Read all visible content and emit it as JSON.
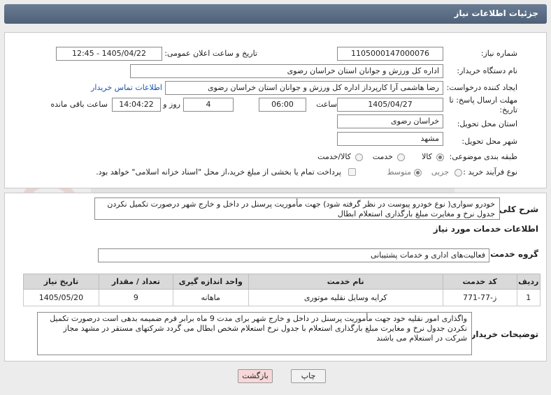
{
  "header": {
    "title": "جزئیات اطلاعات نیاز"
  },
  "fields": {
    "need_number_label": "شماره نیاز:",
    "need_number": "1105000147000076",
    "announce_label": "تاریخ و ساعت اعلان عمومی:",
    "announce_value": "1405/04/22 - 12:45",
    "buyer_org_label": "نام دستگاه خریدار:",
    "buyer_org": "اداره کل ورزش و جوانان استان خراسان رضوی",
    "requester_label": "ایجاد کننده درخواست:",
    "requester": "رضا هاشمی آرا کارپرداز اداره کل ورزش و جوانان استان خراسان رضوی",
    "contact_link": "اطلاعات تماس خریدار",
    "deadline_label_1": "مهلت ارسال پاسخ: تا",
    "deadline_label_2": "تاریخ:",
    "deadline_date": "1405/04/27",
    "time_label": "ساعت",
    "deadline_time": "06:00",
    "days_count": "4",
    "days_label": "روز و",
    "remaining_time": "14:04:22",
    "remaining_label": "ساعت باقی مانده",
    "province_label": "استان محل تحویل:",
    "province": "خراسان رضوی",
    "city_label": "شهر محل تحویل:",
    "city": "مشهد",
    "category_label": "طبقه بندی موضوعی:",
    "category_options": [
      "کالا",
      "خدمت",
      "کالا/خدمت"
    ],
    "purchase_type_label": "نوع فرآیند خرید :",
    "purchase_options": [
      "جزیی",
      "متوسط"
    ],
    "treasury_note": "پرداخت تمام یا بخشی از مبلغ خرید،از محل \"اسناد خزانه اسلامی\" خواهد بود."
  },
  "summary": {
    "label": "شرح کلی نیاز:",
    "text": "خودرو سواری( نوع خودرو پیوست در نظر گرفته شود) جهت مأموریت پرسنل در داخل و خارج شهر درصورت تکمیل نکردن جدول نرخ  و مغایرت مبلغ بارگذاری استعلام ابطال"
  },
  "services": {
    "section_title": "اطلاعات خدمات مورد نیاز",
    "group_label": "گروه خدمت:",
    "group_value": "فعالیت‌های اداری و خدمات پشتیبانی",
    "columns": [
      "ردیف",
      "کد خدمت",
      "نام خدمت",
      "واحد اندازه گیری",
      "تعداد / مقدار",
      "تاریخ نیاز"
    ],
    "rows": [
      [
        "1",
        "ز-77-771",
        "کرایه وسایل نقلیه موتوری",
        "ماهانه",
        "9",
        "1405/05/20"
      ]
    ]
  },
  "buyer_notes": {
    "label": "توضیحات خریدار:",
    "text": "واگذاری امور نقلیه خود جهت مأموریت پرسنل در داخل و خارج شهر برای مدت 9 ماه برابر فرم ضمیمه بدهی است درصورت تکمیل نکردن جدول نرخ  و مغایرت مبلغ بارگذاری استعلام با جدول نرخ استعلام شخص ابطال می گردد شرکتهای مستقر در مشهد مجاز شرکت در استعلام می باشند"
  },
  "buttons": {
    "print": "چاپ",
    "back": "بازگشت"
  },
  "colors": {
    "header": "#4e6178",
    "link": "#1a53a8",
    "back_button": "#f7d7d7"
  }
}
